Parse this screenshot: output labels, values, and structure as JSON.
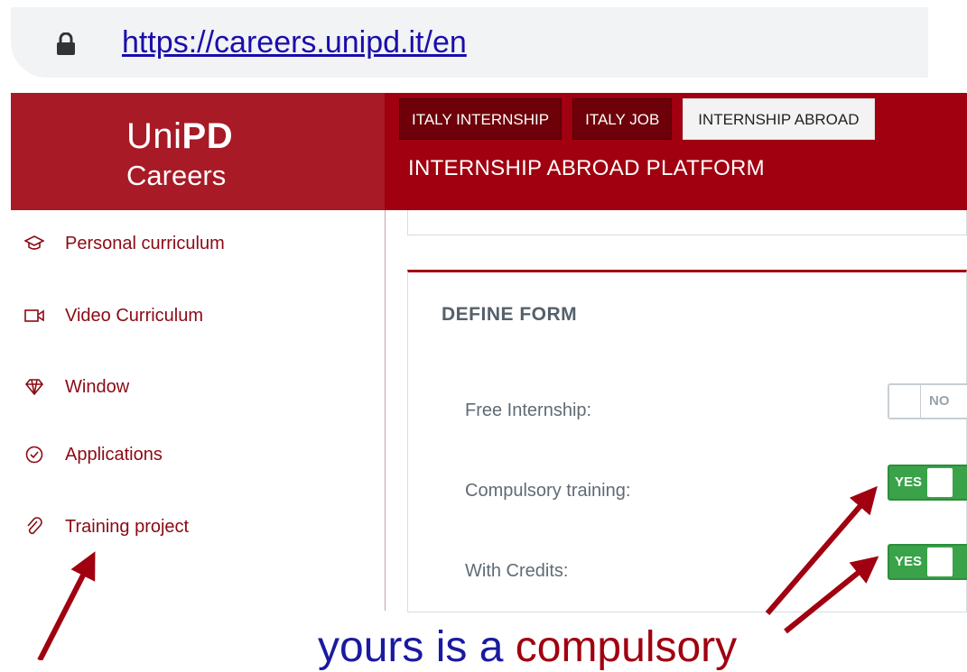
{
  "browser": {
    "url": "https://careers.unipd.it/en"
  },
  "brand": {
    "uni": "Uni",
    "pd": "PD",
    "careers": "Careers"
  },
  "tabs": [
    {
      "label": "ITALY INTERNSHIP",
      "active": false
    },
    {
      "label": "ITALY JOB",
      "active": false
    },
    {
      "label": "INTERNSHIP ABROAD",
      "active": true
    }
  ],
  "platform_title": "INTERNSHIP ABROAD PLATFORM",
  "sidebar": {
    "items": [
      {
        "label": "Personal curriculum",
        "icon": "graduation-cap-icon"
      },
      {
        "label": "Video Curriculum",
        "icon": "video-camera-icon"
      },
      {
        "label": "Window",
        "icon": "diamond-icon"
      },
      {
        "label": "Applications",
        "icon": "check-circle-icon"
      },
      {
        "label": "Training project",
        "icon": "paperclip-icon"
      }
    ]
  },
  "form": {
    "title": "DEFINE FORM",
    "rows": [
      {
        "label": "Free Internship:",
        "value": "NO"
      },
      {
        "label": "Compulsory training:",
        "value": "YES"
      },
      {
        "label": "With Credits:",
        "value": "YES"
      }
    ]
  },
  "annotation": {
    "text_before": "yours is a ",
    "text_highlight": "compulsory"
  },
  "colors": {
    "brand_red": "#a0000f",
    "toggle_green": "#3aa34a",
    "link_blue": "#1a0dab",
    "annotation_blue": "#1a1aa0"
  }
}
